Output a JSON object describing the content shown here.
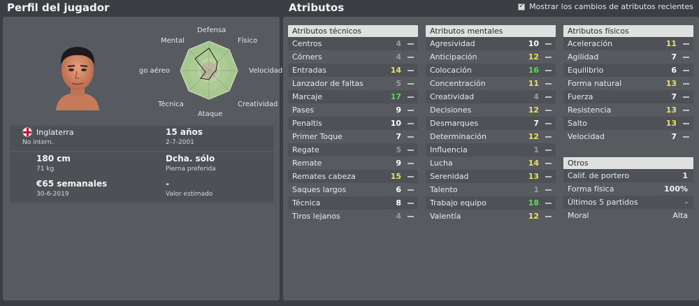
{
  "header": {
    "left_title": "Perfil del jugador",
    "right_title": "Atributos",
    "show_changes_label": "Mostrar los cambios de atributos recientes",
    "show_changes_checked": true
  },
  "radar": {
    "labels": {
      "defensa": "Defensa",
      "fisico": "Físico",
      "velocidad": "Velocidad",
      "creatividad": "Creatividad",
      "ataque": "Ataque",
      "tecnica": "Técnica",
      "juego_aereo": "Juego aéreo",
      "mental": "Mental"
    }
  },
  "profile": {
    "nationality": "Inglaterra",
    "caps": "No intern.",
    "age": "15 años",
    "birthdate": "2-7-2001",
    "height": "180 cm",
    "weight": "71 kg",
    "foot": "Dcha. sólo",
    "foot_label": "Pierna preferida",
    "wage": "€65 semanales",
    "contract_end": "30-6-2019",
    "value": "-",
    "value_label": "Valor estimado"
  },
  "technical": {
    "title": "Atributos técnicos",
    "items": [
      {
        "label": "Centros",
        "value": "4",
        "color": "m"
      },
      {
        "label": "Córners",
        "value": "4",
        "color": "m"
      },
      {
        "label": "Entradas",
        "value": "14",
        "color": "y"
      },
      {
        "label": "Lanzador de faltas",
        "value": "5",
        "color": "m"
      },
      {
        "label": "Marcaje",
        "value": "17",
        "color": "g"
      },
      {
        "label": "Pases",
        "value": "9",
        "color": "w"
      },
      {
        "label": "Penaltis",
        "value": "10",
        "color": "w"
      },
      {
        "label": "Primer Toque",
        "value": "7",
        "color": "w"
      },
      {
        "label": "Regate",
        "value": "5",
        "color": "m"
      },
      {
        "label": "Remate",
        "value": "9",
        "color": "w"
      },
      {
        "label": "Remates cabeza",
        "value": "15",
        "color": "y"
      },
      {
        "label": "Saques largos",
        "value": "6",
        "color": "w"
      },
      {
        "label": "Técnica",
        "value": "8",
        "color": "w"
      },
      {
        "label": "Tiros lejanos",
        "value": "4",
        "color": "m"
      }
    ]
  },
  "mental": {
    "title": "Atributos mentales",
    "items": [
      {
        "label": "Agresividad",
        "value": "10",
        "color": "w"
      },
      {
        "label": "Anticipación",
        "value": "12",
        "color": "y"
      },
      {
        "label": "Colocación",
        "value": "16",
        "color": "g"
      },
      {
        "label": "Concentración",
        "value": "11",
        "color": "y"
      },
      {
        "label": "Creatividad",
        "value": "4",
        "color": "m"
      },
      {
        "label": "Decisiones",
        "value": "12",
        "color": "y"
      },
      {
        "label": "Desmarques",
        "value": "7",
        "color": "w"
      },
      {
        "label": "Determinación",
        "value": "12",
        "color": "y"
      },
      {
        "label": "Influencia",
        "value": "1",
        "color": "m"
      },
      {
        "label": "Lucha",
        "value": "14",
        "color": "y"
      },
      {
        "label": "Serenidad",
        "value": "13",
        "color": "y"
      },
      {
        "label": "Talento",
        "value": "1",
        "color": "m"
      },
      {
        "label": "Trabajo equipo",
        "value": "18",
        "color": "g"
      },
      {
        "label": "Valentía",
        "value": "12",
        "color": "y"
      }
    ]
  },
  "physical": {
    "title": "Atributos físicos",
    "items": [
      {
        "label": "Aceleración",
        "value": "11",
        "color": "y"
      },
      {
        "label": "Agilidad",
        "value": "7",
        "color": "w"
      },
      {
        "label": "Equilibrio",
        "value": "6",
        "color": "w"
      },
      {
        "label": "Forma natural",
        "value": "13",
        "color": "y"
      },
      {
        "label": "Fuerza",
        "value": "7",
        "color": "w"
      },
      {
        "label": "Resistencia",
        "value": "13",
        "color": "y"
      },
      {
        "label": "Salto",
        "value": "13",
        "color": "y"
      },
      {
        "label": "Velocidad",
        "value": "7",
        "color": "w"
      }
    ]
  },
  "others": {
    "title": "Otros",
    "items": [
      {
        "label": "Calif. de portero",
        "value": "1",
        "bold": true
      },
      {
        "label": "Forma física",
        "value": "100%",
        "bold": true
      },
      {
        "label": "Últimos 5 partidos",
        "value": "-",
        "bold": false
      },
      {
        "label": "Moral",
        "value": "Alta",
        "bold": false
      }
    ]
  },
  "colors": {
    "high": "#5fd65a",
    "good": "#e8e06a",
    "normal": "#ffffff",
    "low": "#9a9a9a"
  }
}
